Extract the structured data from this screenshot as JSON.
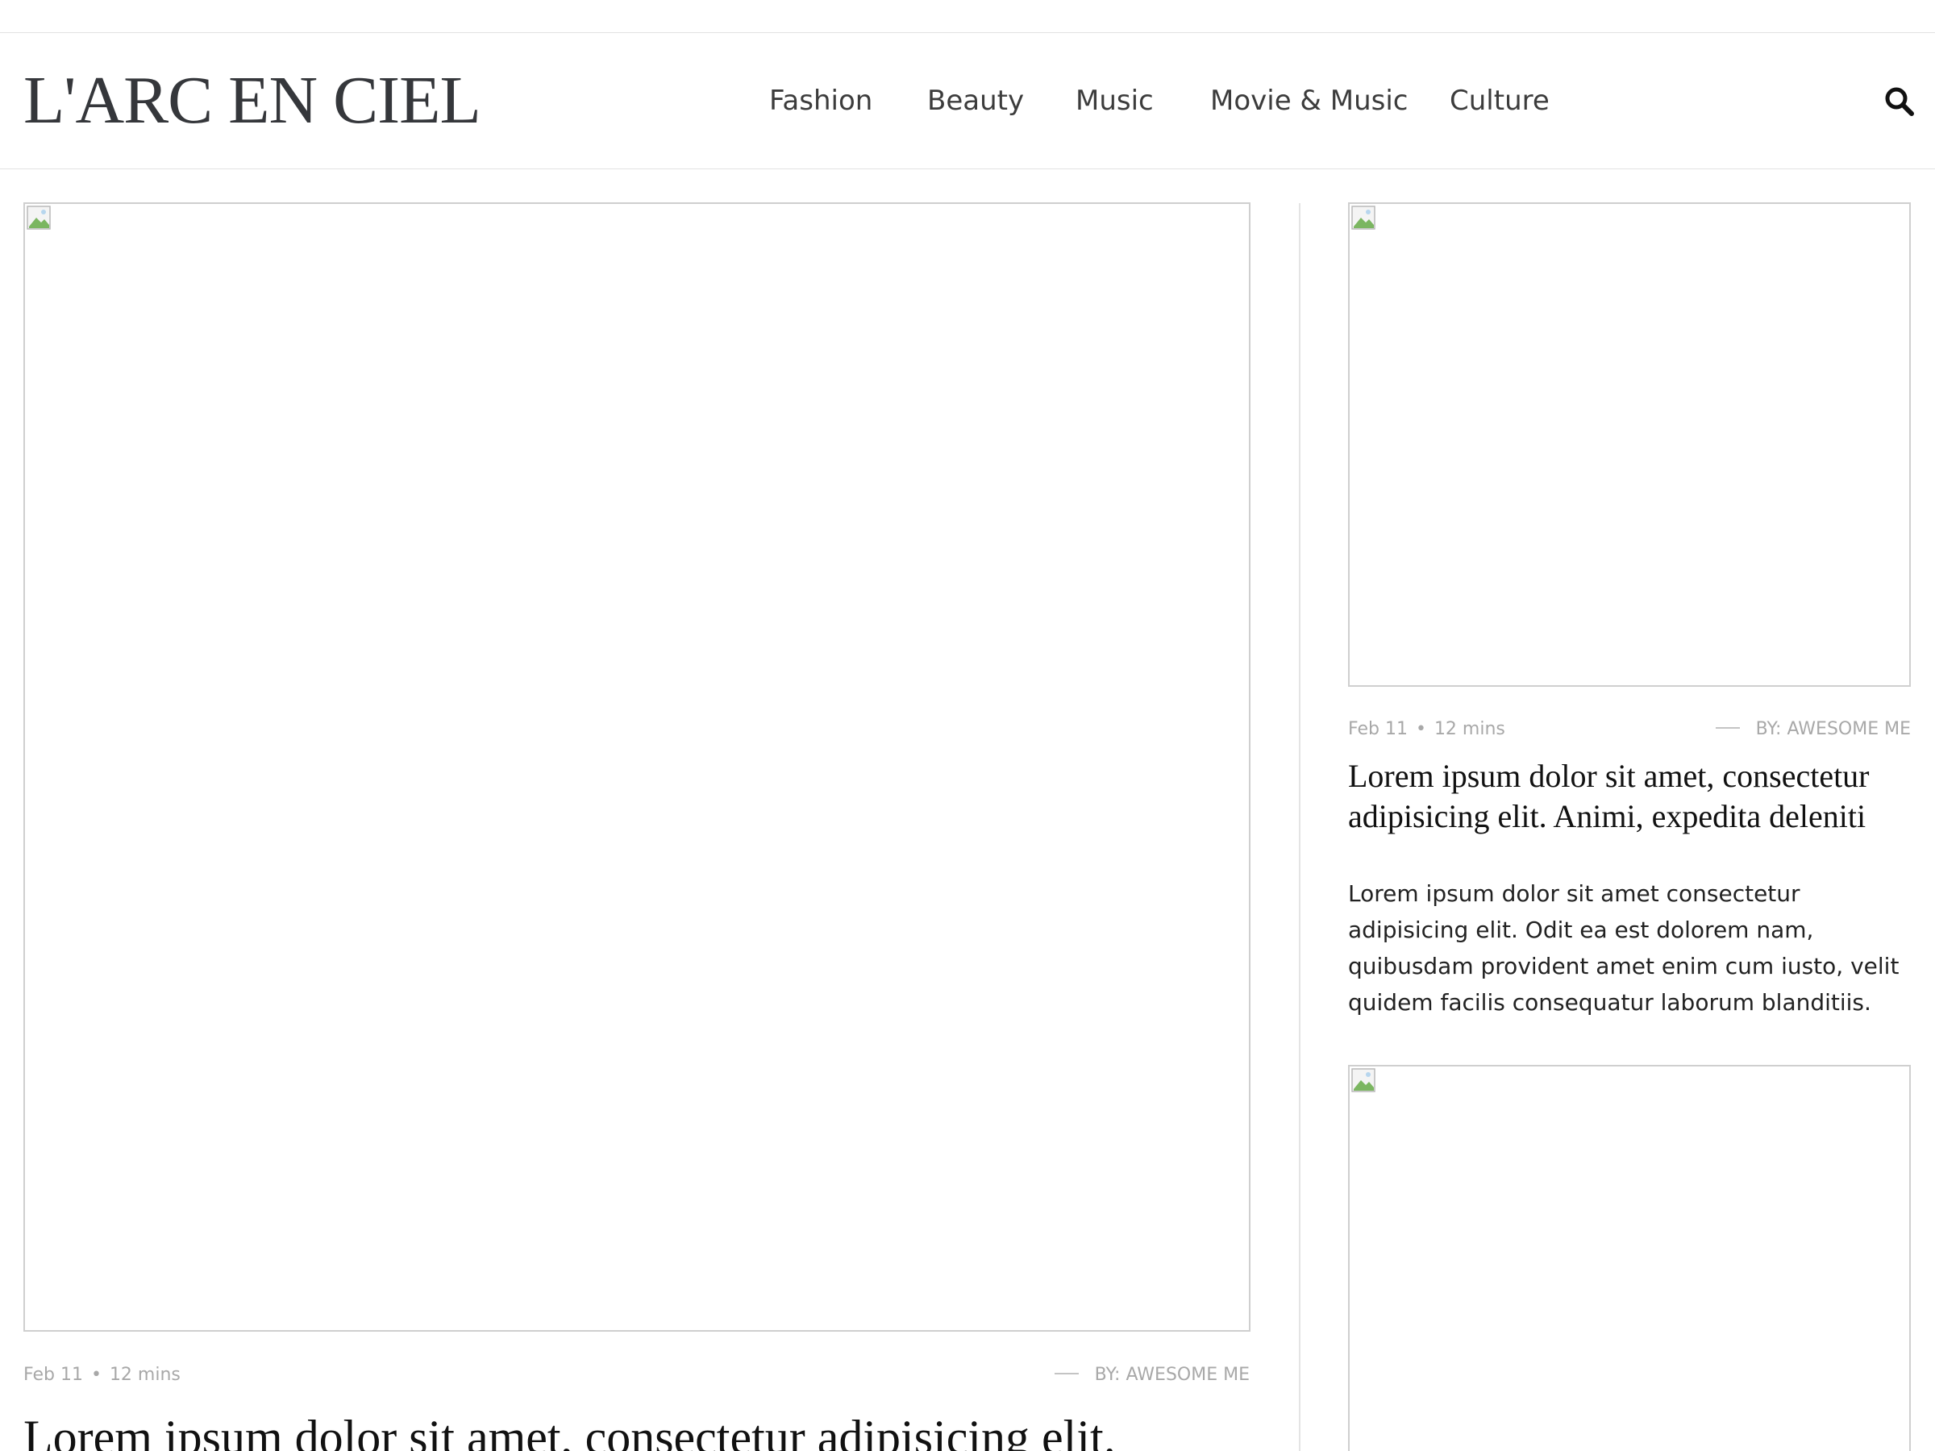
{
  "site": {
    "logo": "L'ARC EN CIEL"
  },
  "nav": {
    "items": [
      {
        "label": "Fashion"
      },
      {
        "label": "Beauty"
      },
      {
        "label": "Music"
      },
      {
        "label": "Movie & Music"
      },
      {
        "label": "Culture"
      }
    ],
    "search_icon": "search-icon"
  },
  "featured": {
    "image_icon": "broken-image-icon",
    "date": "Feb 11",
    "bullet": "•",
    "read_time": "12 mins",
    "author": "BY: AWESOME ME",
    "title": "Lorem ipsum dolor sit amet, consectetur adipisicing elit."
  },
  "sidebar": {
    "articles": [
      {
        "image_icon": "broken-image-icon",
        "date": "Feb 11",
        "bullet": "•",
        "read_time": "12 mins",
        "author": "BY: AWESOME ME",
        "title": "Lorem ipsum dolor sit amet, consectetur adipisicing elit. Animi, expedita deleniti",
        "excerpt": "Lorem ipsum dolor sit amet consectetur adipisicing elit. Odit ea est dolorem nam, quibusdam provident amet enim cum iusto, velit quidem facilis consequatur laborum blanditiis."
      },
      {
        "image_icon": "broken-image-icon"
      }
    ]
  },
  "colors": {
    "logo": "#35373b",
    "nav_text": "#3c3c3c",
    "meta_text": "#a8a8a8",
    "border": "#cfcfcf",
    "divider": "#e4e4e4"
  }
}
